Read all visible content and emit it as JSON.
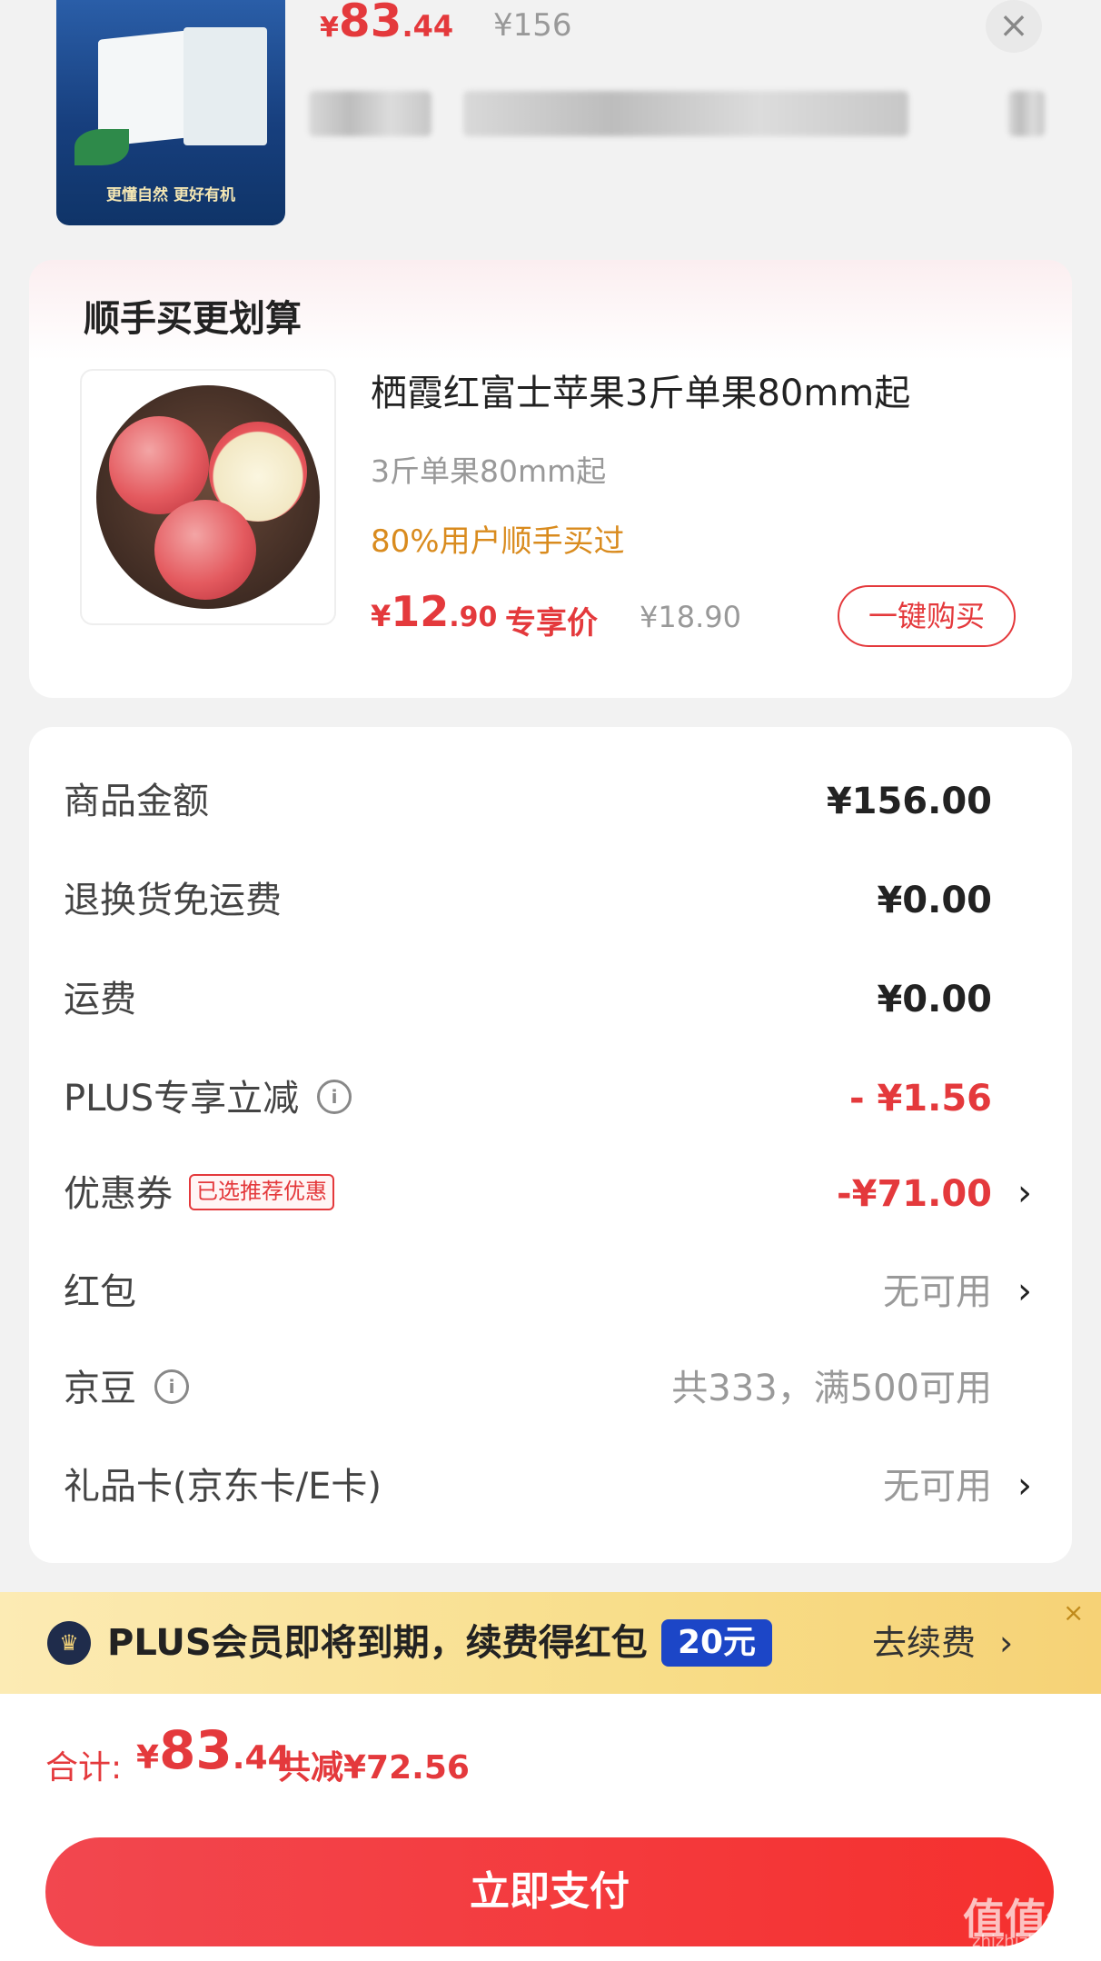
{
  "top_item": {
    "thumb_slogan": "更懂自然 更好有机",
    "price": {
      "currency": "¥",
      "integer": "83",
      "decimal": ".44"
    },
    "original_price": "¥156",
    "close_icon": "close-icon"
  },
  "addon": {
    "title": "顺手买更划算",
    "product_name": "栖霞红富士苹果3斤单果80mm起",
    "spec": "3斤单果80mm起",
    "hint": "80%用户顺手买过",
    "price": {
      "currency": "¥",
      "integer": "12",
      "decimal": ".90"
    },
    "exclusive_label": "专享价",
    "original_price": "¥18.90",
    "buy_button": "一键购买"
  },
  "summary": {
    "rows": [
      {
        "label": "商品金额",
        "value": "¥156.00"
      },
      {
        "label": "退换货免运费",
        "value": "¥0.00"
      },
      {
        "label": "运费",
        "value": "¥0.00"
      },
      {
        "label": "PLUS专享立减",
        "value": "- ¥1.56",
        "info_icon": "info-icon"
      },
      {
        "label": "优惠券",
        "tag": "已选推荐优惠",
        "value": "-¥71.00",
        "chevron": "›"
      },
      {
        "label": "红包",
        "value": "无可用",
        "chevron": "›"
      },
      {
        "label": "京豆",
        "value": "共333，满500可用",
        "info_icon": "info-icon"
      },
      {
        "label": "礼品卡(京东卡/E卡)",
        "value": "无可用",
        "chevron": "›"
      }
    ]
  },
  "plus_banner": {
    "text": "PLUS会员即将到期，续费得红包",
    "badge": "20元",
    "action": "去续费",
    "chevron": "›",
    "close": "×"
  },
  "total": {
    "label": "合计:",
    "price": {
      "currency": "¥",
      "integer": "83",
      "decimal": ".44"
    },
    "saved": "共减¥72.56"
  },
  "pay_button": "立即支付",
  "watermark": {
    "main": "值值值",
    "sub": "zhizhizhi.com"
  },
  "colors": {
    "accent": "#e4393c",
    "gold": "#d98b1e",
    "plus_blue": "#1c46c7"
  }
}
